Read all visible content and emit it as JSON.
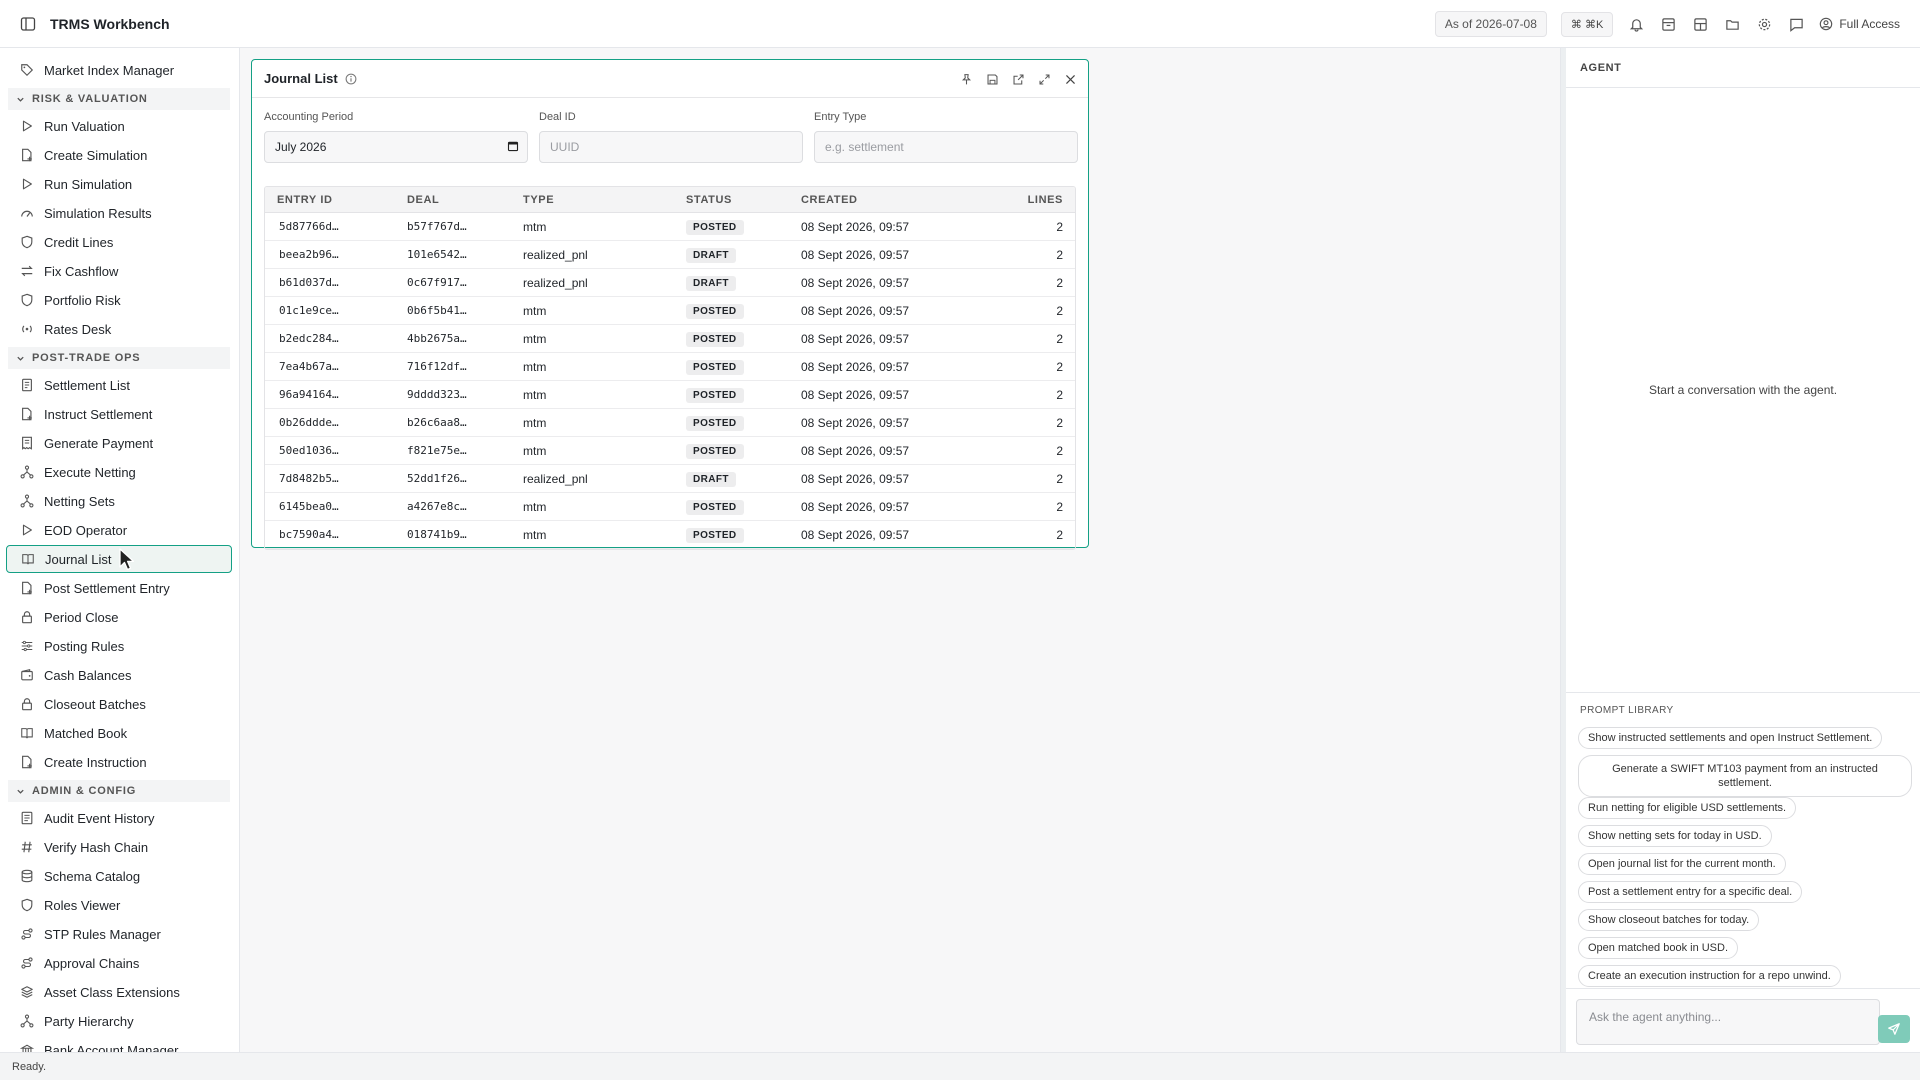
{
  "app": {
    "title": "TRMS Workbench",
    "as_of": "As of 2026-07-08",
    "shortcut": "⌘ ⌘K",
    "access": "Full Access"
  },
  "sidebar": {
    "items": [
      {
        "label": "Market Index Manager",
        "icon": "tag-icon"
      },
      {
        "section": "RISK & VALUATION"
      },
      {
        "label": "Run Valuation",
        "icon": "play-icon"
      },
      {
        "label": "Create Simulation",
        "icon": "file-plus-icon"
      },
      {
        "label": "Run Simulation",
        "icon": "play-icon"
      },
      {
        "label": "Simulation Results",
        "icon": "gauge-icon"
      },
      {
        "label": "Credit Lines",
        "icon": "shield-icon"
      },
      {
        "label": "Fix Cashflow",
        "icon": "swap-icon"
      },
      {
        "label": "Portfolio Risk",
        "icon": "shield-icon"
      },
      {
        "label": "Rates Desk",
        "icon": "radio-icon"
      },
      {
        "section": "POST-TRADE OPS"
      },
      {
        "label": "Settlement List",
        "icon": "list-icon"
      },
      {
        "label": "Instruct Settlement",
        "icon": "file-plus-icon"
      },
      {
        "label": "Generate Payment",
        "icon": "receipt-icon"
      },
      {
        "label": "Execute Netting",
        "icon": "network-icon"
      },
      {
        "label": "Netting Sets",
        "icon": "network-icon"
      },
      {
        "label": "EOD Operator",
        "icon": "play-icon"
      },
      {
        "label": "Journal List",
        "icon": "book-icon",
        "active": true
      },
      {
        "label": "Post Settlement Entry",
        "icon": "file-plus-icon"
      },
      {
        "label": "Period Close",
        "icon": "lock-icon"
      },
      {
        "label": "Posting Rules",
        "icon": "sliders-icon"
      },
      {
        "label": "Cash Balances",
        "icon": "wallet-icon"
      },
      {
        "label": "Closeout Batches",
        "icon": "lock-icon"
      },
      {
        "label": "Matched Book",
        "icon": "book-icon"
      },
      {
        "label": "Create Instruction",
        "icon": "file-plus-icon"
      },
      {
        "section": "ADMIN & CONFIG"
      },
      {
        "label": "Audit Event History",
        "icon": "history-icon"
      },
      {
        "label": "Verify Hash Chain",
        "icon": "hash-icon"
      },
      {
        "label": "Schema Catalog",
        "icon": "database-icon"
      },
      {
        "label": "Roles Viewer",
        "icon": "shield-icon"
      },
      {
        "label": "STP Rules Manager",
        "icon": "route-icon"
      },
      {
        "label": "Approval Chains",
        "icon": "route-icon"
      },
      {
        "label": "Asset Class Extensions",
        "icon": "layers-icon"
      },
      {
        "label": "Party Hierarchy",
        "icon": "network-icon"
      },
      {
        "label": "Bank Account Manager",
        "icon": "bank-icon"
      }
    ]
  },
  "journal": {
    "title": "Journal List",
    "filters": {
      "period_label": "Accounting Period",
      "period_value": "July 2026",
      "deal_label": "Deal ID",
      "deal_placeholder": "UUID",
      "type_label": "Entry Type",
      "type_placeholder": "e.g. settlement"
    },
    "columns": [
      "ENTRY ID",
      "DEAL",
      "TYPE",
      "STATUS",
      "CREATED",
      "LINES"
    ],
    "rows": [
      [
        "5d87766d…",
        "b57f767d…",
        "mtm",
        "POSTED",
        "08 Sept 2026, 09:57",
        "2"
      ],
      [
        "beea2b96…",
        "101e6542…",
        "realized_pnl",
        "DRAFT",
        "08 Sept 2026, 09:57",
        "2"
      ],
      [
        "b61d037d…",
        "0c67f917…",
        "realized_pnl",
        "DRAFT",
        "08 Sept 2026, 09:57",
        "2"
      ],
      [
        "01c1e9ce…",
        "0b6f5b41…",
        "mtm",
        "POSTED",
        "08 Sept 2026, 09:57",
        "2"
      ],
      [
        "b2edc284…",
        "4bb2675a…",
        "mtm",
        "POSTED",
        "08 Sept 2026, 09:57",
        "2"
      ],
      [
        "7ea4b67a…",
        "716f12df…",
        "mtm",
        "POSTED",
        "08 Sept 2026, 09:57",
        "2"
      ],
      [
        "96a94164…",
        "9dddd323…",
        "mtm",
        "POSTED",
        "08 Sept 2026, 09:57",
        "2"
      ],
      [
        "0b26ddde…",
        "b26c6aa8…",
        "mtm",
        "POSTED",
        "08 Sept 2026, 09:57",
        "2"
      ],
      [
        "50ed1036…",
        "f821e75e…",
        "mtm",
        "POSTED",
        "08 Sept 2026, 09:57",
        "2"
      ],
      [
        "7d8482b5…",
        "52dd1f26…",
        "realized_pnl",
        "DRAFT",
        "08 Sept 2026, 09:57",
        "2"
      ],
      [
        "6145bea0…",
        "a4267e8c…",
        "mtm",
        "POSTED",
        "08 Sept 2026, 09:57",
        "2"
      ],
      [
        "bc7590a4…",
        "018741b9…",
        "mtm",
        "POSTED",
        "08 Sept 2026, 09:57",
        "2"
      ]
    ]
  },
  "agent": {
    "title": "AGENT",
    "empty": "Start a conversation with the agent.",
    "library_title": "PROMPT LIBRARY",
    "prompts": [
      "Show instructed settlements and open Instruct Settlement.",
      "Generate a SWIFT MT103 payment from an instructed settlement.",
      "Run netting for eligible USD settlements.",
      "Show netting sets for today in USD.",
      "Open journal list for the current month.",
      "Post a settlement entry for a specific deal.",
      "Show closeout batches for today.",
      "Open matched book in USD.",
      "Create an execution instruction for a repo unwind."
    ],
    "input_placeholder": "Ask the agent anything..."
  },
  "status": "Ready.",
  "colors": {
    "accent": "#14a085",
    "send": "#7fcbb9"
  }
}
